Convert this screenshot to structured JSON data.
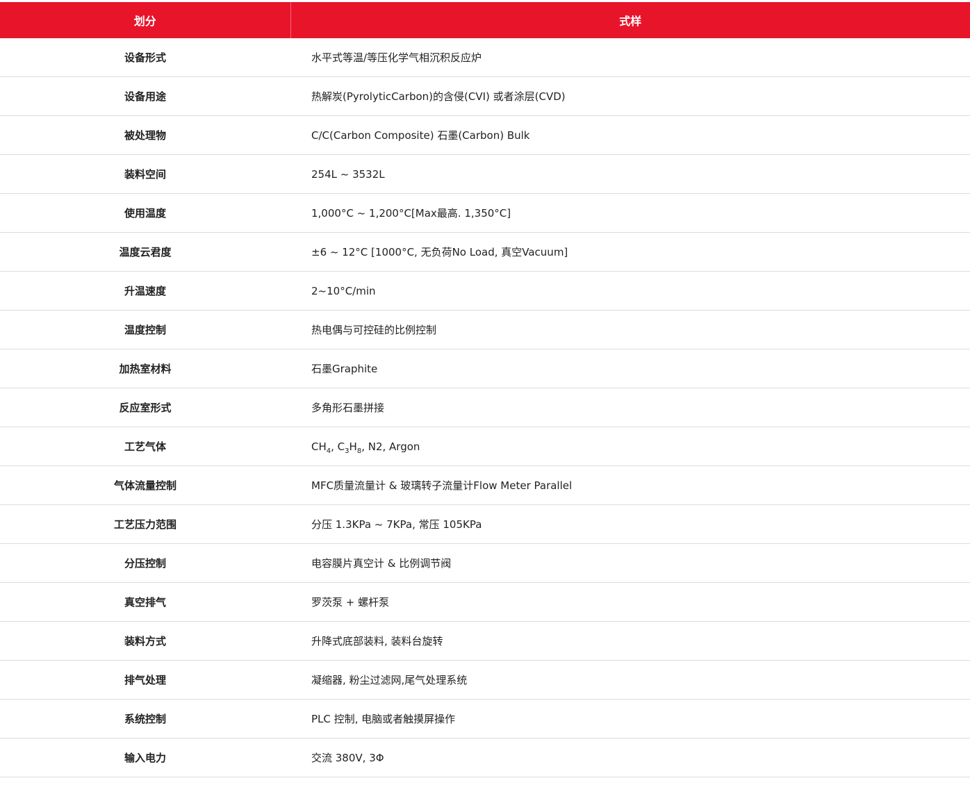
{
  "header": {
    "col1": "划分",
    "col2": "式样"
  },
  "rows": [
    {
      "label": "设备形式",
      "value": "水平式等温/等压化学气相沉积反应炉"
    },
    {
      "label": "设备用途",
      "value": "热解炭(PyrolyticCarbon)的含侵(CVI) 或者涂层(CVD)"
    },
    {
      "label": "被处理物",
      "value": "C/C(Carbon Composite) 石墨(Carbon) Bulk"
    },
    {
      "label": "装料空间",
      "value": "254L ~ 3532L"
    },
    {
      "label": "使用温度",
      "value": "1,000°C ~ 1,200°C[Max最高. 1,350°C]"
    },
    {
      "label": "温度云君度",
      "value": "±6 ~ 12°C [1000°C, 无负荷No Load, 真空Vacuum]"
    },
    {
      "label": "升温速度",
      "value": "2~10°C/min"
    },
    {
      "label": "温度控制",
      "value": "热电偶与可控硅的比例控制"
    },
    {
      "label": "加热室材料",
      "value": "石墨Graphite"
    },
    {
      "label": "反应室形式",
      "value": "多角形石墨拼接"
    },
    {
      "label": "工艺气体",
      "value_parts": {
        "ch": "CH",
        "ch_sub": "4",
        "sep1": ", C",
        "c_sub": "3",
        "h": "H",
        "h_sub": "8",
        "rest": ", N2, Argon"
      }
    },
    {
      "label": "气体流量控制",
      "value": "MFC质量流量计 & 玻璃转子流量计Flow Meter Parallel"
    },
    {
      "label": "工艺压力范围",
      "value": "分压 1.3KPa ~ 7KPa, 常压 105KPa"
    },
    {
      "label": "分压控制",
      "value": "电容膜片真空计 & 比例调节阀"
    },
    {
      "label": "真空排气",
      "value": "罗茨泵 + 螺杆泵"
    },
    {
      "label": "装料方式",
      "value": "升降式底部装料, 装料台旋转"
    },
    {
      "label": "排气处理",
      "value": "凝缩器, 粉尘过滤网,尾气处理系统"
    },
    {
      "label": "系统控制",
      "value": "PLC 控制, 电脑或者触摸屏操作"
    },
    {
      "label": "输入电力",
      "value": "交流 380V, 3Φ"
    }
  ],
  "colors": {
    "header_bg": "#e8142a",
    "header_text": "#ffffff",
    "row_border": "#dcdcdc",
    "body_text": "#222222"
  }
}
